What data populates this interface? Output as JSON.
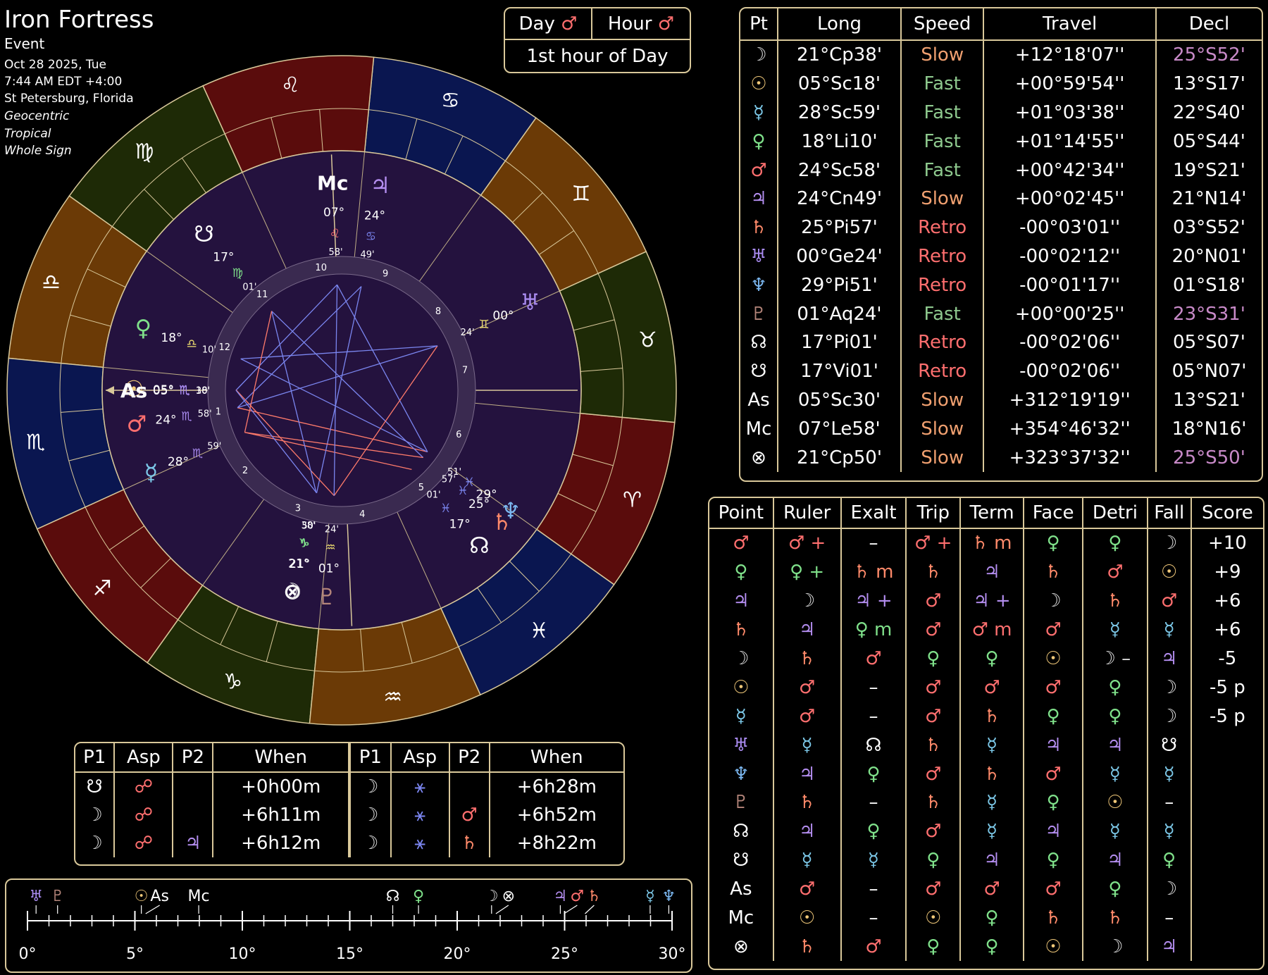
{
  "header": {
    "name": "Iron Fortress",
    "type": "Event",
    "date": "Oct 28 2025, Tue",
    "time": "7:44 AM EDT +4:00",
    "place": "St Petersburg, Florida",
    "opt1": "Geocentric",
    "opt2": "Tropical",
    "opt3": "Whole Sign"
  },
  "colors": {
    "mars": "#ff6f6f",
    "venus": "#7fe08a",
    "jupiter": "#b48ef0",
    "saturn": "#ff8a6a",
    "sun": "#f0c879",
    "moon": "#dddddd",
    "mercury": "#7cc8e8",
    "uranus": "#a98bf0",
    "neptune": "#7bb7f0",
    "pluto": "#b4857a",
    "gold": "#d9c89a",
    "bg_wheel": "#24123e"
  },
  "dayhour": {
    "day_label": "Day",
    "day_glyph": "♂",
    "hour_label": "Hour",
    "hour_glyph": "♂",
    "hour_text": "1st hour of Day"
  },
  "positions": {
    "headers": [
      "Pt",
      "Long",
      "Speed",
      "Travel",
      "Decl"
    ],
    "rows": [
      {
        "glyph": "☽",
        "gc": "#dddddd",
        "long": "21°Cp38'",
        "speed": "Slow",
        "sc": "#f0a070",
        "travel": "+12°18'07''",
        "decl": "25°S52'",
        "dc": "#c88ac8"
      },
      {
        "glyph": "☉",
        "gc": "#f0c879",
        "long": "05°Sc18'",
        "speed": "Fast",
        "sc": "#8ec98e",
        "travel": "+00°59'54''",
        "decl": "13°S17'",
        "dc": "#ffffff"
      },
      {
        "glyph": "☿",
        "gc": "#7cc8e8",
        "long": "28°Sc59'",
        "speed": "Fast",
        "sc": "#8ec98e",
        "travel": "+01°03'38''",
        "decl": "22°S40'",
        "dc": "#ffffff"
      },
      {
        "glyph": "♀",
        "gc": "#7fe08a",
        "long": "18°Li10'",
        "speed": "Fast",
        "sc": "#8ec98e",
        "travel": "+01°14'55''",
        "decl": "05°S44'",
        "dc": "#ffffff"
      },
      {
        "glyph": "♂",
        "gc": "#ff6f6f",
        "long": "24°Sc58'",
        "speed": "Fast",
        "sc": "#8ec98e",
        "travel": "+00°42'34''",
        "decl": "19°S21'",
        "dc": "#ffffff"
      },
      {
        "glyph": "♃",
        "gc": "#b48ef0",
        "long": "24°Cn49'",
        "speed": "Slow",
        "sc": "#f0a070",
        "travel": "+00°02'45''",
        "decl": "21°N14'",
        "dc": "#ffffff"
      },
      {
        "glyph": "♄",
        "gc": "#ff8a6a",
        "long": "25°Pi57'",
        "speed": "Retro",
        "sc": "#ff6f6f",
        "travel": "-00°03'01''",
        "decl": "03°S52'",
        "dc": "#ffffff"
      },
      {
        "glyph": "♅",
        "gc": "#a98bf0",
        "long": "00°Ge24'",
        "speed": "Retro",
        "sc": "#ff6f6f",
        "travel": "-00°02'12''",
        "decl": "20°N01'",
        "dc": "#ffffff"
      },
      {
        "glyph": "♆",
        "gc": "#7bb7f0",
        "long": "29°Pi51'",
        "speed": "Retro",
        "sc": "#ff6f6f",
        "travel": "-00°01'17''",
        "decl": "01°S18'",
        "dc": "#ffffff"
      },
      {
        "glyph": "♇",
        "gc": "#b4857a",
        "long": "01°Aq24'",
        "speed": "Fast",
        "sc": "#8ec98e",
        "travel": "+00°00'25''",
        "decl": "23°S31'",
        "dc": "#c88ac8"
      },
      {
        "glyph": "☊",
        "gc": "#ffffff",
        "long": "17°Pi01'",
        "speed": "Retro",
        "sc": "#ff6f6f",
        "travel": "-00°02'06''",
        "decl": "05°S07'",
        "dc": "#ffffff"
      },
      {
        "glyph": "☋",
        "gc": "#ffffff",
        "long": "17°Vi01'",
        "speed": "Retro",
        "sc": "#ff6f6f",
        "travel": "-00°02'06''",
        "decl": "05°N07'",
        "dc": "#ffffff"
      },
      {
        "glyph": "As",
        "gc": "#ffffff",
        "long": "05°Sc30'",
        "speed": "Slow",
        "sc": "#f0a070",
        "travel": "+312°19'19''",
        "decl": "13°S21'",
        "dc": "#ffffff"
      },
      {
        "glyph": "Mc",
        "gc": "#ffffff",
        "long": "07°Le58'",
        "speed": "Slow",
        "sc": "#f0a070",
        "travel": "+354°46'32''",
        "decl": "18°N16'",
        "dc": "#ffffff"
      },
      {
        "glyph": "⊗",
        "gc": "#ffffff",
        "long": "21°Cp50'",
        "speed": "Slow",
        "sc": "#f0a070",
        "travel": "+323°37'32''",
        "decl": "25°S50'",
        "dc": "#c88ac8"
      }
    ]
  },
  "dignities": {
    "headers": [
      "Point",
      "Ruler",
      "Exalt",
      "Trip",
      "Term",
      "Face",
      "Detri",
      "Fall",
      "Score"
    ],
    "rows": [
      {
        "pt": "♂",
        "ptc": "#ff6f6f",
        "cells": [
          [
            "♂ +",
            "#ff6f6f"
          ],
          [
            "–",
            "#ffffff"
          ],
          [
            "♂ +",
            "#ff6f6f"
          ],
          [
            "♄ m",
            "#ff8a6a"
          ],
          [
            "♀",
            "#7fe08a"
          ],
          [
            "♀",
            "#7fe08a"
          ],
          [
            "☽",
            "#dddddd"
          ]
        ],
        "score": "+10"
      },
      {
        "pt": "♀",
        "ptc": "#7fe08a",
        "cells": [
          [
            "♀ +",
            "#7fe08a"
          ],
          [
            "♄ m",
            "#ff8a6a"
          ],
          [
            "♄",
            "#ff8a6a"
          ],
          [
            "♃",
            "#b48ef0"
          ],
          [
            "♄",
            "#ff8a6a"
          ],
          [
            "♂",
            "#ff6f6f"
          ],
          [
            "☉",
            "#f0c879"
          ]
        ],
        "score": "+9"
      },
      {
        "pt": "♃",
        "ptc": "#b48ef0",
        "cells": [
          [
            "☽",
            "#dddddd"
          ],
          [
            "♃ +",
            "#b48ef0"
          ],
          [
            "♂",
            "#ff6f6f"
          ],
          [
            "♃ +",
            "#b48ef0"
          ],
          [
            "☽",
            "#dddddd"
          ],
          [
            "♄",
            "#ff8a6a"
          ],
          [
            "♂",
            "#ff6f6f"
          ]
        ],
        "score": "+6"
      },
      {
        "pt": "♄",
        "ptc": "#ff8a6a",
        "cells": [
          [
            "♃",
            "#b48ef0"
          ],
          [
            "♀ m",
            "#7fe08a"
          ],
          [
            "♂",
            "#ff6f6f"
          ],
          [
            "♂ m",
            "#ff6f6f"
          ],
          [
            "♂",
            "#ff6f6f"
          ],
          [
            "☿",
            "#7cc8e8"
          ],
          [
            "☿",
            "#7cc8e8"
          ]
        ],
        "score": "+6"
      },
      {
        "pt": "☽",
        "ptc": "#dddddd",
        "cells": [
          [
            "♄",
            "#ff8a6a"
          ],
          [
            "♂",
            "#ff6f6f"
          ],
          [
            "♀",
            "#7fe08a"
          ],
          [
            "♀",
            "#7fe08a"
          ],
          [
            "☉",
            "#f0c879"
          ],
          [
            "☽ –",
            "#dddddd"
          ],
          [
            "♃",
            "#b48ef0"
          ]
        ],
        "score": "-5"
      },
      {
        "pt": "☉",
        "ptc": "#f0c879",
        "cells": [
          [
            "♂",
            "#ff6f6f"
          ],
          [
            "–",
            "#ffffff"
          ],
          [
            "♂",
            "#ff6f6f"
          ],
          [
            "♂",
            "#ff6f6f"
          ],
          [
            "♂",
            "#ff6f6f"
          ],
          [
            "♀",
            "#7fe08a"
          ],
          [
            "☽",
            "#dddddd"
          ]
        ],
        "score": "-5 p"
      },
      {
        "pt": "☿",
        "ptc": "#7cc8e8",
        "cells": [
          [
            "♂",
            "#ff6f6f"
          ],
          [
            "–",
            "#ffffff"
          ],
          [
            "♂",
            "#ff6f6f"
          ],
          [
            "♄",
            "#ff8a6a"
          ],
          [
            "♀",
            "#7fe08a"
          ],
          [
            "♀",
            "#7fe08a"
          ],
          [
            "☽",
            "#dddddd"
          ]
        ],
        "score": "-5 p"
      },
      {
        "pt": "♅",
        "ptc": "#a98bf0",
        "cells": [
          [
            "☿",
            "#7cc8e8"
          ],
          [
            "☊",
            "#ffffff"
          ],
          [
            "♄",
            "#ff8a6a"
          ],
          [
            "☿",
            "#7cc8e8"
          ],
          [
            "♃",
            "#b48ef0"
          ],
          [
            "♃",
            "#b48ef0"
          ],
          [
            "☋",
            "#ffffff"
          ]
        ],
        "score": ""
      },
      {
        "pt": "♆",
        "ptc": "#7bb7f0",
        "cells": [
          [
            "♃",
            "#b48ef0"
          ],
          [
            "♀",
            "#7fe08a"
          ],
          [
            "♂",
            "#ff6f6f"
          ],
          [
            "♄",
            "#ff8a6a"
          ],
          [
            "♂",
            "#ff6f6f"
          ],
          [
            "☿",
            "#7cc8e8"
          ],
          [
            "☿",
            "#7cc8e8"
          ]
        ],
        "score": ""
      },
      {
        "pt": "♇",
        "ptc": "#b4857a",
        "cells": [
          [
            "♄",
            "#ff8a6a"
          ],
          [
            "–",
            "#ffffff"
          ],
          [
            "♄",
            "#ff8a6a"
          ],
          [
            "☿",
            "#7cc8e8"
          ],
          [
            "♀",
            "#7fe08a"
          ],
          [
            "☉",
            "#f0c879"
          ],
          [
            "–",
            "#ffffff"
          ]
        ],
        "score": ""
      },
      {
        "pt": "☊",
        "ptc": "#ffffff",
        "cells": [
          [
            "♃",
            "#b48ef0"
          ],
          [
            "♀",
            "#7fe08a"
          ],
          [
            "♂",
            "#ff6f6f"
          ],
          [
            "☿",
            "#7cc8e8"
          ],
          [
            "♃",
            "#b48ef0"
          ],
          [
            "☿",
            "#7cc8e8"
          ],
          [
            "☿",
            "#7cc8e8"
          ]
        ],
        "score": ""
      },
      {
        "pt": "☋",
        "ptc": "#ffffff",
        "cells": [
          [
            "☿",
            "#7cc8e8"
          ],
          [
            "☿",
            "#7cc8e8"
          ],
          [
            "♀",
            "#7fe08a"
          ],
          [
            "♃",
            "#b48ef0"
          ],
          [
            "♀",
            "#7fe08a"
          ],
          [
            "♃",
            "#b48ef0"
          ],
          [
            "♀",
            "#7fe08a"
          ]
        ],
        "score": ""
      },
      {
        "pt": "As",
        "ptc": "#ffffff",
        "cells": [
          [
            "♂",
            "#ff6f6f"
          ],
          [
            "–",
            "#ffffff"
          ],
          [
            "♂",
            "#ff6f6f"
          ],
          [
            "♂",
            "#ff6f6f"
          ],
          [
            "♂",
            "#ff6f6f"
          ],
          [
            "♀",
            "#7fe08a"
          ],
          [
            "☽",
            "#dddddd"
          ]
        ],
        "score": ""
      },
      {
        "pt": "Mc",
        "ptc": "#ffffff",
        "cells": [
          [
            "☉",
            "#f0c879"
          ],
          [
            "–",
            "#ffffff"
          ],
          [
            "☉",
            "#f0c879"
          ],
          [
            "♀",
            "#7fe08a"
          ],
          [
            "♄",
            "#ff8a6a"
          ],
          [
            "♄",
            "#ff8a6a"
          ],
          [
            "–",
            "#ffffff"
          ]
        ],
        "score": ""
      },
      {
        "pt": "⊗",
        "ptc": "#ffffff",
        "cells": [
          [
            "♄",
            "#ff8a6a"
          ],
          [
            "♂",
            "#ff6f6f"
          ],
          [
            "♀",
            "#7fe08a"
          ],
          [
            "♀",
            "#7fe08a"
          ],
          [
            "☉",
            "#f0c879"
          ],
          [
            "☽",
            "#dddddd"
          ],
          [
            "♃",
            "#b48ef0"
          ]
        ],
        "score": ""
      }
    ]
  },
  "aspects": {
    "headers": [
      "P1",
      "Asp",
      "P2",
      "When",
      "P1",
      "Asp",
      "P2",
      "When"
    ],
    "rows": [
      [
        [
          "☋",
          "#ffffff"
        ],
        [
          "☍",
          "#ff6f6f"
        ],
        [
          "",
          ""
        ],
        [
          "+0h00m",
          "#ffffff"
        ],
        [
          "☽",
          "#dddddd"
        ],
        [
          "⚹",
          "#7b86f0"
        ],
        [
          "",
          ""
        ],
        [
          "+6h28m",
          "#ffffff"
        ]
      ],
      [
        [
          "☽",
          "#dddddd"
        ],
        [
          "☍",
          "#ff6f6f"
        ],
        [
          "",
          ""
        ],
        [
          "+6h11m",
          "#ffffff"
        ],
        [
          "☽",
          "#dddddd"
        ],
        [
          "⚹",
          "#7b86f0"
        ],
        [
          "♂",
          "#ff6f6f"
        ],
        [
          "+6h52m",
          "#ffffff"
        ]
      ],
      [
        [
          "☽",
          "#dddddd"
        ],
        [
          "☍",
          "#ff6f6f"
        ],
        [
          "♃",
          "#b48ef0"
        ],
        [
          "+6h12m",
          "#ffffff"
        ],
        [
          "☽",
          "#dddddd"
        ],
        [
          "⚹",
          "#7b86f0"
        ],
        [
          "♄",
          "#ff8a6a"
        ],
        [
          "+8h22m",
          "#ffffff"
        ]
      ]
    ]
  },
  "strip": {
    "ticks": [
      "0°",
      "5°",
      "10°",
      "15°",
      "20°",
      "25°",
      "30°"
    ],
    "items": [
      {
        "g": "♅",
        "c": "#a98bf0",
        "deg": 0.4
      },
      {
        "g": "♇",
        "c": "#b4857a",
        "deg": 1.4
      },
      {
        "g": "☉",
        "c": "#f0c879",
        "deg": 5.3
      },
      {
        "g": "As",
        "c": "#ffffff",
        "deg": 5.5
      },
      {
        "g": "Mc",
        "c": "#ffffff",
        "deg": 7.97
      },
      {
        "g": "☊",
        "c": "#ffffff",
        "deg": 17.0
      },
      {
        "g": "♀",
        "c": "#7fe08a",
        "deg": 18.2
      },
      {
        "g": "☽",
        "c": "#dddddd",
        "deg": 21.6
      },
      {
        "g": "⊗",
        "c": "#ffffff",
        "deg": 21.8
      },
      {
        "g": "♃",
        "c": "#b48ef0",
        "deg": 24.8
      },
      {
        "g": "♂",
        "c": "#ff6f6f",
        "deg": 24.97
      },
      {
        "g": "♄",
        "c": "#ff8a6a",
        "deg": 25.95
      },
      {
        "g": "☿",
        "c": "#7cc8e8",
        "deg": 28.98
      },
      {
        "g": "♆",
        "c": "#7bb7f0",
        "deg": 29.85
      }
    ]
  },
  "wheel": {
    "signs": [
      "♈",
      "♉",
      "♊",
      "♋",
      "♌",
      "♍",
      "♎",
      "♏",
      "♐",
      "♑",
      "♒",
      "♓"
    ],
    "sign_colors": [
      "#5a0c0c",
      "#1e2a06",
      "#6b3a06",
      "#0a1650",
      "#5a0c0c",
      "#1e2a06",
      "#6b3a06",
      "#0a1650",
      "#5a0c0c",
      "#1e2a06",
      "#6b3a06",
      "#0a1650"
    ],
    "asc_deg": 215.5,
    "house_numbers": [
      "1",
      "2",
      "3",
      "4",
      "5",
      "6",
      "7",
      "8",
      "9",
      "10",
      "11",
      "12"
    ],
    "planets": [
      {
        "g": "☉",
        "c": "#f0c879",
        "lon": 215.3,
        "deg": "05°",
        "sign": "♏",
        "min": "18'",
        "sc": "#a98bf0"
      },
      {
        "g": "As",
        "c": "#ffffff",
        "lon": 215.5,
        "deg": "05°",
        "sign": "♏",
        "min": "30'",
        "sc": "#a98bf0"
      },
      {
        "g": "♂",
        "c": "#ff6f6f",
        "lon": 224.97,
        "deg": "24°",
        "sign": "♏",
        "min": "58'",
        "sc": "#a98bf0"
      },
      {
        "g": "☿",
        "c": "#7cc8e8",
        "lon": 238.98,
        "deg": "28°",
        "sign": "♏",
        "min": "59'",
        "sc": "#a98bf0"
      },
      {
        "g": "♀",
        "c": "#7fe08a",
        "lon": 198.2,
        "deg": "18°",
        "sign": "♎",
        "min": "10'",
        "sc": "#f0e070"
      },
      {
        "g": "☋",
        "c": "#ffffff",
        "lon": 167.0,
        "deg": "17°",
        "sign": "♍",
        "min": "01'",
        "sc": "#7fe08a"
      },
      {
        "g": "Mc",
        "c": "#ffffff",
        "lon": 127.97,
        "deg": "07°",
        "sign": "♌",
        "min": "58'",
        "sc": "#ff6f6f"
      },
      {
        "g": "♃",
        "c": "#b48ef0",
        "lon": 114.8,
        "deg": "24°",
        "sign": "♋",
        "min": "49'",
        "sc": "#7b86f0"
      },
      {
        "g": "♅",
        "c": "#a98bf0",
        "lon": 60.4,
        "deg": "00°",
        "sign": "♊",
        "min": "24'",
        "sc": "#f0e070"
      },
      {
        "g": "♆",
        "c": "#7bb7f0",
        "lon": 359.85,
        "deg": "29°",
        "sign": "♓",
        "min": "51'",
        "sc": "#7b86f0"
      },
      {
        "g": "♄",
        "c": "#ff8a6a",
        "lon": 355.95,
        "deg": "25°",
        "sign": "♓",
        "min": "57'",
        "sc": "#7b86f0"
      },
      {
        "g": "☊",
        "c": "#ffffff",
        "lon": 347.0,
        "deg": "17°",
        "sign": "♓",
        "min": "01'",
        "sc": "#7b86f0"
      },
      {
        "g": "♇",
        "c": "#b4857a",
        "lon": 301.4,
        "deg": "01°",
        "sign": "♒",
        "min": "24'",
        "sc": "#f0e070"
      },
      {
        "g": "⊗",
        "c": "#ffffff",
        "lon": 291.83,
        "deg": "21°",
        "sign": "♑",
        "min": "50'",
        "sc": "#7fe08a"
      },
      {
        "g": "☽",
        "c": "#dddddd",
        "lon": 291.6,
        "deg": "21°",
        "sign": "♑",
        "min": "38'",
        "sc": "#7fe08a"
      }
    ]
  }
}
